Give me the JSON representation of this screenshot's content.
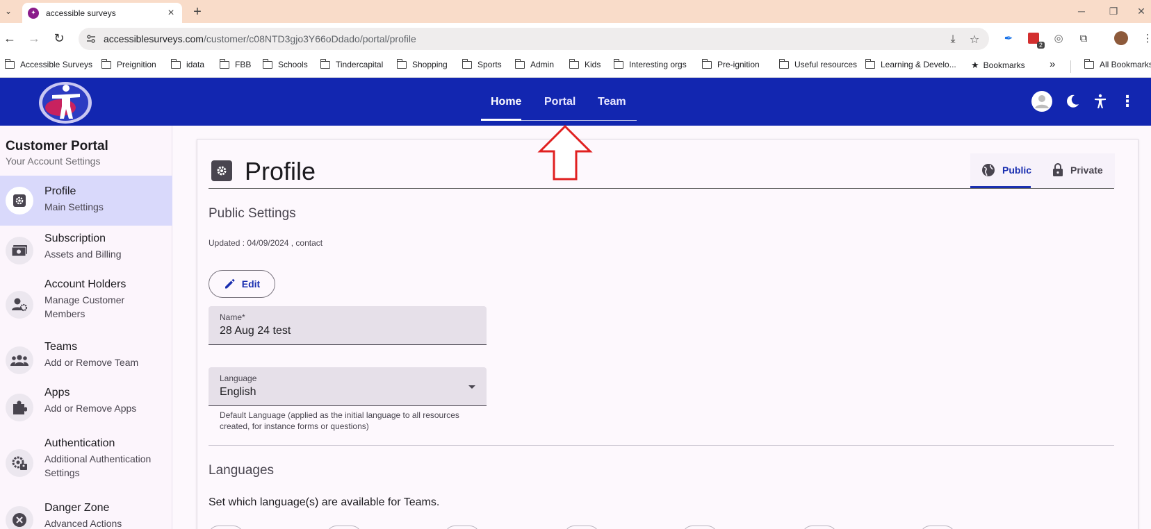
{
  "browser": {
    "tab_title": "accessible surveys",
    "url_host": "accessiblesurveys.com",
    "url_path": "/customer/c08NTD3gjo3Y66oDdado/portal/profile",
    "ext_badge": "2",
    "bookmarks": [
      {
        "label": "Accessible Surveys"
      },
      {
        "label": "Preignition"
      },
      {
        "label": "idata"
      },
      {
        "label": "FBB"
      },
      {
        "label": "Schools"
      },
      {
        "label": "Tindercapital"
      },
      {
        "label": "Shopping"
      },
      {
        "label": "Sports"
      },
      {
        "label": "Admin"
      },
      {
        "label": "Kids"
      },
      {
        "label": "Interesting orgs"
      },
      {
        "label": "Pre-ignition"
      },
      {
        "label": "Useful resources"
      },
      {
        "label": "Learning & Develo..."
      },
      {
        "label": "Bookmarks"
      }
    ],
    "overflow": "»",
    "all_bookmarks": "All Bookmarks"
  },
  "header": {
    "nav": [
      {
        "label": "Home"
      },
      {
        "label": "Portal"
      },
      {
        "label": "Team"
      }
    ],
    "accent": "#1226b0"
  },
  "sidebar": {
    "title": "Customer Portal",
    "subtitle": "Your Account Settings",
    "items": [
      {
        "label": "Profile",
        "desc": "Main Settings",
        "icon": "gear-icon"
      },
      {
        "label": "Subscription",
        "desc": "Assets and Billing",
        "icon": "money-icon"
      },
      {
        "label": "Account Holders",
        "desc": "Manage Customer Members",
        "icon": "person-gear-icon"
      },
      {
        "label": "Teams",
        "desc": "Add or Remove Team",
        "icon": "group-icon"
      },
      {
        "label": "Apps",
        "desc": "Add or Remove Apps",
        "icon": "puzzle-icon"
      },
      {
        "label": "Authentication",
        "desc": "Additional Authentication Settings",
        "icon": "auth-icon"
      },
      {
        "label": "Danger Zone",
        "desc": "Advanced Actions",
        "icon": "close-circle-icon"
      }
    ]
  },
  "main": {
    "title": "Profile",
    "tabs": [
      {
        "label": "Public"
      },
      {
        "label": "Private"
      }
    ],
    "public_settings": {
      "title": "Public Settings",
      "updated": "Updated : 04/09/2024 , contact",
      "edit_label": "Edit",
      "name_label": "Name*",
      "name_value": "28 Aug 24 test",
      "language_label": "Language",
      "language_value": "English",
      "language_helper": "Default Language (applied as the initial language to all resources created, for instance forms or questions)"
    },
    "languages": {
      "title": "Languages",
      "desc": "Set which language(s) are available for Teams."
    }
  }
}
